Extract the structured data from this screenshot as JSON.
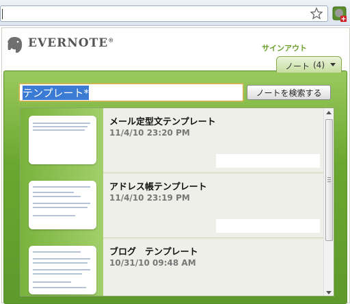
{
  "popup": {
    "logo_text": "EVERNOTE",
    "logo_mark": "®",
    "signout": "サインアウト",
    "tab": {
      "label": "ノート",
      "count": "(4)"
    },
    "search": {
      "value": "テンプレート*",
      "button": "ノートを検索する"
    }
  },
  "notes": [
    {
      "title": "メール定型文テンプレート",
      "date": "11/4/10 23:20 PM"
    },
    {
      "title": "アドレス帳テンプレート",
      "date": "11/4/10 23:19 PM"
    },
    {
      "title": "ブログ　テンプレート",
      "date": "10/31/10 09:48 AM"
    }
  ],
  "colors": {
    "accent_green": "#6aa731",
    "signout": "#6aa02a"
  }
}
